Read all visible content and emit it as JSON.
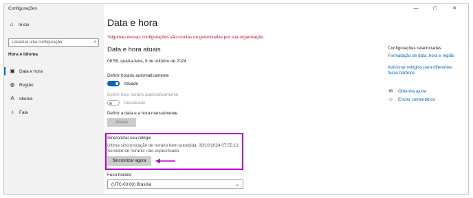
{
  "window": {
    "title": "Configurações",
    "controls": [
      "—",
      "▢",
      "✕"
    ]
  },
  "sidebar": {
    "home_label": "Início",
    "search_placeholder": "Localizar uma configuração",
    "section_title": "Hora e Idioma",
    "items": [
      {
        "label": "Data e hora",
        "icon": "calendar-clock-icon",
        "active": true
      },
      {
        "label": "Região",
        "icon": "globe-region-icon",
        "active": false
      },
      {
        "label": "Idioma",
        "icon": "language-icon",
        "active": false
      },
      {
        "label": "Fala",
        "icon": "microphone-icon",
        "active": false
      }
    ]
  },
  "main": {
    "title": "Data e hora",
    "warning": "*Algumas dessas configurações são ocultas ou gerenciadas por sua organização.",
    "current_heading": "Data e hora atuais",
    "current_datetime": "08:58, quarta-feira, 9 de outubro de 2024",
    "auto_time": {
      "label": "Definir horário automaticamente",
      "state_text": "Ativado",
      "on": true
    },
    "auto_timezone": {
      "label": "Definir fuso horário automaticamente",
      "state_text": "Desativado",
      "on": false
    },
    "manual": {
      "label": "Definir a data e a hora manualmente",
      "button": "Alterar"
    },
    "sync": {
      "heading": "Sincronizar seu relógio",
      "last_sync": "Última sincronização de horário bem-sucedida: 09/10/2024 07:55:13",
      "server": "Servidor de horário: não especificado",
      "button": "Sincronizar agora"
    },
    "timezone": {
      "label": "Fuso horário",
      "value": "(UTC-03:00) Brasília"
    }
  },
  "related": {
    "heading": "Configurações relacionadas",
    "links": [
      "Formatação de data, hora e região",
      "Adicionar relógios para diferentes fusos horários"
    ],
    "help": [
      {
        "label": "Obtenha ajuda",
        "icon": "help-chat-icon"
      },
      {
        "label": "Enviar comentários",
        "icon": "feedback-person-icon"
      }
    ]
  },
  "colors": {
    "accent": "#0067c0",
    "highlight": "#b300cc",
    "warning": "#c50f1f"
  }
}
